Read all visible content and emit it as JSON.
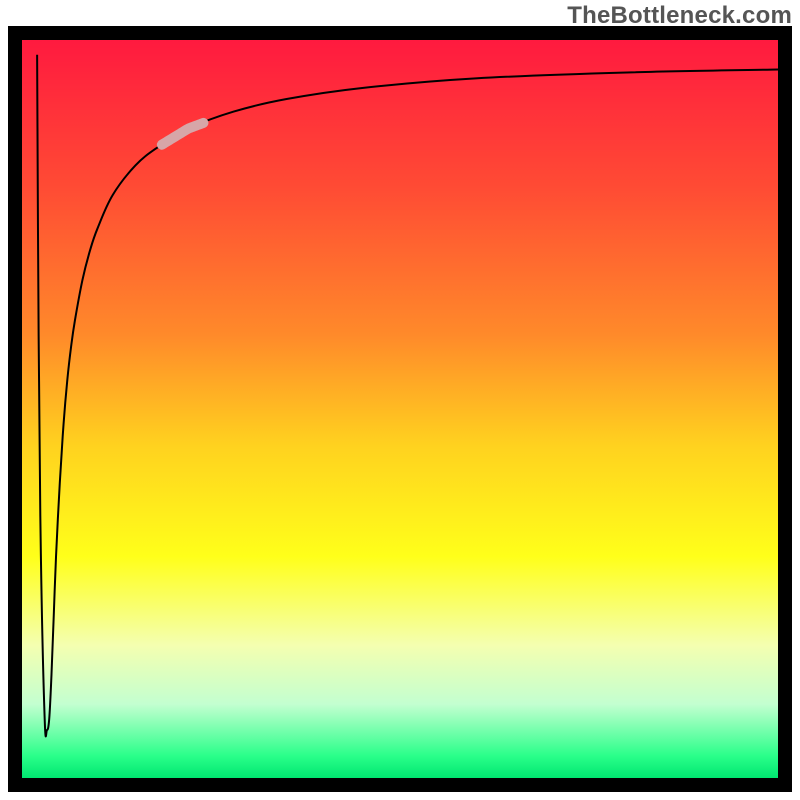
{
  "watermark": "TheBottleneck.com",
  "chart_data": {
    "type": "line",
    "title": "",
    "xlabel": "",
    "ylabel": "",
    "xlim": [
      0,
      100
    ],
    "ylim": [
      0,
      100
    ],
    "axes_visible": false,
    "grid": false,
    "legend": false,
    "background": {
      "type": "vertical-gradient",
      "stops": [
        {
          "pos": 0.0,
          "color": "#ff1a3f"
        },
        {
          "pos": 0.2,
          "color": "#ff4b34"
        },
        {
          "pos": 0.4,
          "color": "#ff8a2a"
        },
        {
          "pos": 0.55,
          "color": "#ffd21f"
        },
        {
          "pos": 0.7,
          "color": "#ffff1a"
        },
        {
          "pos": 0.82,
          "color": "#f4ffb0"
        },
        {
          "pos": 0.9,
          "color": "#c3ffd0"
        },
        {
          "pos": 0.97,
          "color": "#2aff8a"
        },
        {
          "pos": 1.0,
          "color": "#00e670"
        }
      ]
    },
    "series": [
      {
        "name": "curve",
        "color": "#000000",
        "width": 2,
        "x": [
          2.0,
          2.2,
          2.5,
          3.0,
          3.3,
          3.6,
          3.9,
          4.2,
          4.5,
          5.0,
          5.5,
          6.0,
          6.5,
          7.0,
          8.0,
          9.0,
          10.0,
          12.0,
          15.0,
          18.0,
          22.0,
          28.0,
          35.0,
          45.0,
          60.0,
          80.0,
          100.0
        ],
        "y": [
          98.0,
          60.0,
          30.0,
          8.0,
          6.5,
          8.0,
          14.0,
          22.0,
          30.0,
          40.0,
          48.0,
          54.0,
          58.5,
          62.0,
          67.5,
          71.5,
          74.5,
          79.0,
          83.0,
          85.5,
          88.0,
          90.3,
          92.0,
          93.5,
          94.8,
          95.6,
          96.0
        ]
      }
    ],
    "highlight_segment": {
      "x_range": [
        18.5,
        24.0
      ],
      "color": "#d7a6a8",
      "width": 10,
      "note": "faded pink overlay on ascending curve"
    }
  }
}
